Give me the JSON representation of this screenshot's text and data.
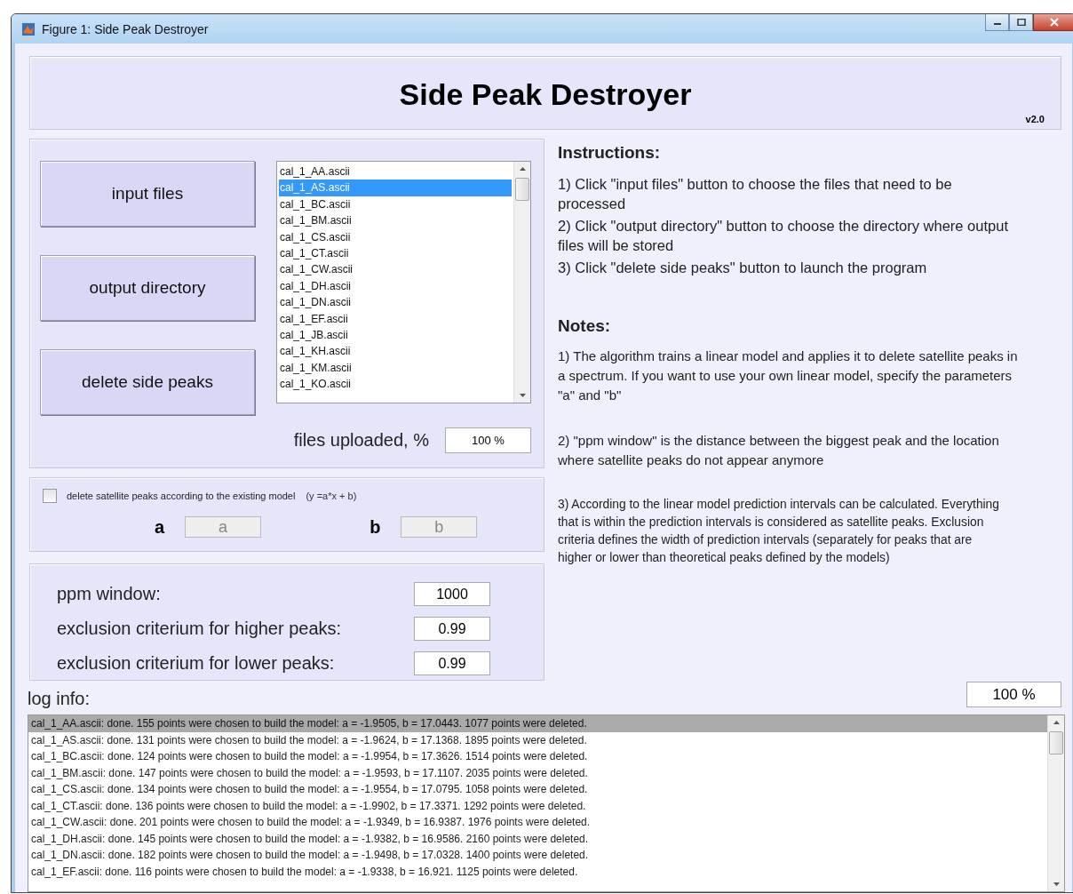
{
  "window": {
    "title": "Figure 1: Side Peak Destroyer"
  },
  "header": {
    "title": "Side Peak Destroyer",
    "version": "v2.0"
  },
  "buttons": [
    "input files",
    "output directory",
    "delete side peaks"
  ],
  "file_list": {
    "items": [
      {
        "label": "cal_1_AA.ascii",
        "selected": false
      },
      {
        "label": "cal_1_AS.ascii",
        "selected": true
      },
      {
        "label": "cal_1_BC.ascii",
        "selected": false
      },
      {
        "label": "cal_1_BM.ascii",
        "selected": false
      },
      {
        "label": "cal_1_CS.ascii",
        "selected": false
      },
      {
        "label": "cal_1_CT.ascii",
        "selected": false
      },
      {
        "label": "cal_1_CW.ascii",
        "selected": false
      },
      {
        "label": "cal_1_DH.ascii",
        "selected": false
      },
      {
        "label": "cal_1_DN.ascii",
        "selected": false
      },
      {
        "label": "cal_1_EF.ascii",
        "selected": false
      },
      {
        "label": "cal_1_JB.ascii",
        "selected": false
      },
      {
        "label": "cal_1_KH.ascii",
        "selected": false
      },
      {
        "label": "cal_1_KM.ascii",
        "selected": false
      },
      {
        "label": "cal_1_KO.ascii",
        "selected": false
      }
    ]
  },
  "files_uploaded": {
    "label": "files uploaded, %",
    "value": "100 %"
  },
  "model": {
    "checkbox_label": "delete satellite peaks according to the existing model",
    "formula": "(y =a*x + b)",
    "checked": false,
    "params": [
      {
        "label": "a",
        "placeholder": "a",
        "disabled": true
      },
      {
        "label": "b",
        "placeholder": "b",
        "disabled": true
      }
    ]
  },
  "settings": [
    {
      "label": "ppm window:",
      "value": "1000"
    },
    {
      "label": "exclusion criterium for higher peaks:",
      "value": "0.99"
    },
    {
      "label": "exclusion criterium for lower peaks:",
      "value": "0.99"
    }
  ],
  "instructions": {
    "heading": "Instructions:",
    "items": [
      "1) Click \"input files\" button to choose the files that need to be processed",
      "2) Click \"output directory\" button to choose the directory where output files will be stored",
      "3) Click \"delete side peaks\" button to launch the program"
    ]
  },
  "notes": {
    "heading": "Notes:",
    "items": [
      "1) The algorithm trains a linear model and applies it to delete satellite peaks in a spectrum. If you want to use your own linear model, specify the parameters \"a\" and \"b\"",
      "2) \"ppm window\" is the distance between the biggest peak and the location where satellite peaks do not appear anymore",
      "3) According to the linear model prediction intervals can be calculated. Everything that is within the prediction intervals is considered as satellite peaks. Exclusion criteria defines the width of prediction intervals (separately for peaks that are higher or lower than theoretical peaks defined by the models)"
    ]
  },
  "log": {
    "label": "log info:",
    "progress": "100 %",
    "rows": [
      {
        "text": "cal_1_AA.ascii: done. 155 points were chosen to build the model: a = -1.9505, b = 17.0443. 1077 points were deleted.",
        "selected": true
      },
      {
        "text": "cal_1_AS.ascii: done. 131 points were chosen to build the model: a = -1.9624, b = 17.1368. 1895 points were deleted.",
        "selected": false
      },
      {
        "text": "cal_1_BC.ascii: done. 124 points were chosen to build the model: a = -1.9954, b = 17.3626. 1514 points were deleted.",
        "selected": false
      },
      {
        "text": "cal_1_BM.ascii: done. 147 points were chosen to build the model: a = -1.9593, b = 17.1107. 2035 points were deleted.",
        "selected": false
      },
      {
        "text": "cal_1_CS.ascii: done. 134 points were chosen to build the model: a = -1.9554, b = 17.0795. 1058 points were deleted.",
        "selected": false
      },
      {
        "text": "cal_1_CT.ascii: done. 136 points were chosen to build the model: a = -1.9902, b = 17.3371. 1292 points were deleted.",
        "selected": false
      },
      {
        "text": "cal_1_CW.ascii: done. 201 points were chosen to build the model: a = -1.9349, b = 16.9387. 1976 points were deleted.",
        "selected": false
      },
      {
        "text": "cal_1_DH.ascii: done. 145 points were chosen to build the model: a = -1.9382, b = 16.9586. 2160 points were deleted.",
        "selected": false
      },
      {
        "text": "cal_1_DN.ascii: done. 182 points were chosen to build the model: a = -1.9498, b = 17.0328. 1400 points were deleted.",
        "selected": false
      },
      {
        "text": "cal_1_EF.ascii: done. 116 points were chosen to build the model: a = -1.9338, b = 16.921. 1125 points were deleted.",
        "selected": false
      }
    ]
  }
}
